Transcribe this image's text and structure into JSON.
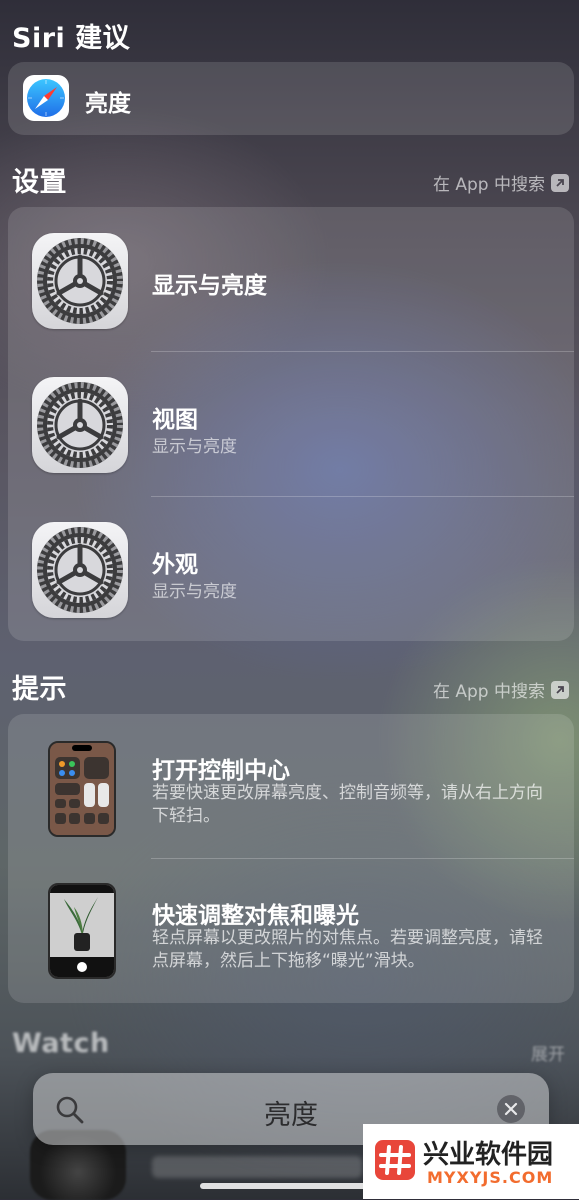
{
  "siri": {
    "title": "Siri 建议",
    "suggestion_label": "亮度"
  },
  "settings": {
    "title": "设置",
    "search_in_app": "在 App 中搜索",
    "items": [
      {
        "title": "显示与亮度",
        "subtitle": ""
      },
      {
        "title": "视图",
        "subtitle": "显示与亮度"
      },
      {
        "title": "外观",
        "subtitle": "显示与亮度"
      }
    ]
  },
  "tips": {
    "title": "提示",
    "search_in_app": "在 App 中搜索",
    "items": [
      {
        "title": "打开控制中心",
        "description": "若要快速更改屏幕亮度、控制音频等，请从右上方向下轻扫。"
      },
      {
        "title": "快速调整对焦和曝光",
        "description": "轻点屏幕以更改照片的对焦点。若要调整亮度，请轻点屏幕，然后上下拖移“曝光”滑块。"
      }
    ]
  },
  "watch": {
    "title": "Watch",
    "expand_label": "展开"
  },
  "search": {
    "query": "亮度"
  },
  "watermark": {
    "brand": "兴业软件园",
    "url": "MYXYJS.COM"
  },
  "colors": {
    "brand_orange": "#f26c2e",
    "brand_red": "#e8463a",
    "safari_blue": "#1f8cf0"
  }
}
